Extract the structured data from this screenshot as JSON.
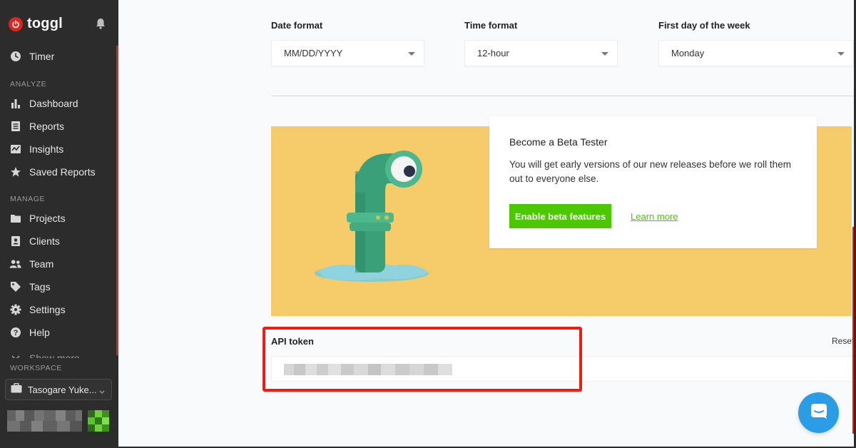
{
  "app": {
    "brand": "toggl"
  },
  "colors": {
    "sidebar_bg": "#2c2c2c",
    "accent_red": "#e0231f",
    "primary_green": "#4bc800",
    "banner_yellow": "#f6cc6b",
    "chat_blue": "#2b9ce6",
    "highlight_red": "#f21b0f"
  },
  "sidebar": {
    "top_item": {
      "label": "Timer",
      "icon": "clock-icon"
    },
    "analyze_heading": "ANALYZE",
    "analyze_items": [
      {
        "label": "Dashboard",
        "icon": "bar-chart-icon"
      },
      {
        "label": "Reports",
        "icon": "document-icon"
      },
      {
        "label": "Insights",
        "icon": "insights-icon"
      },
      {
        "label": "Saved Reports",
        "icon": "star-icon"
      }
    ],
    "manage_heading": "MANAGE",
    "manage_items": [
      {
        "label": "Projects",
        "icon": "folder-icon"
      },
      {
        "label": "Clients",
        "icon": "client-card-icon"
      },
      {
        "label": "Team",
        "icon": "team-icon"
      },
      {
        "label": "Tags",
        "icon": "tag-icon"
      },
      {
        "label": "Settings",
        "icon": "gear-icon"
      },
      {
        "label": "Help",
        "icon": "help-icon"
      }
    ],
    "show_more": "Show more",
    "workspace_heading": "WORKSPACE",
    "workspace_name": "Tasogare Yuke...",
    "bell_icon": "bell-icon"
  },
  "settings": {
    "date_format": {
      "label": "Date format",
      "value": "MM/DD/YYYY"
    },
    "time_format": {
      "label": "Time format",
      "value": "12-hour"
    },
    "first_day": {
      "label": "First day of the week",
      "value": "Monday"
    }
  },
  "beta": {
    "title": "Become a Beta Tester",
    "description": "You will get early versions of our new releases before we roll them out to everyone else.",
    "button": "Enable beta features",
    "link": "Learn more"
  },
  "api": {
    "label": "API token",
    "reset": "Reset"
  },
  "chat": {
    "icon": "chat-icon"
  }
}
